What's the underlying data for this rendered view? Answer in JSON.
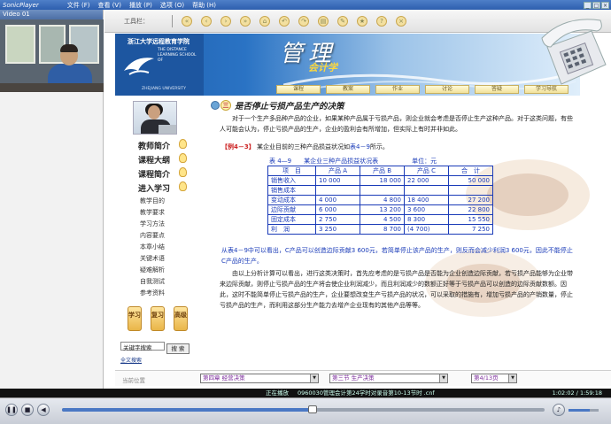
{
  "titlebar": {
    "app_name": "SonicPlayer",
    "menu": [
      "文件 (F)",
      "查看 (V)",
      "播放 (P)",
      "选项 (O)",
      "帮助 (H)"
    ]
  },
  "video_panel": {
    "title": "Video 01"
  },
  "toolbar": {
    "label": "工具栏："
  },
  "banner": {
    "school_cn": "浙江大学远程教育学院",
    "school_en": "THE DISTANCE LEARNING SCHOOL OF",
    "univ": "ZHEJIANG UNIVERSITY",
    "title_main": "管理",
    "title_sub": "会计学"
  },
  "nav_tabs": [
    "课程",
    "教案",
    "作业",
    "讨论",
    "答疑",
    "学习导航"
  ],
  "sidenav": {
    "main": [
      "教师简介",
      "课程大纲",
      "课程简介",
      "进入学习"
    ],
    "sub": [
      "教学目的",
      "教学要求",
      "学习方法",
      "内容要点",
      "本章小结",
      "关键术语",
      "疑难解析",
      "自我测试",
      "参考资料"
    ],
    "buttons": [
      "学习",
      "复习",
      "高级"
    ],
    "search_value": "关键字搜索",
    "search_button": "搜 索",
    "advanced_search": "全文搜索"
  },
  "content": {
    "section_no": "三",
    "section_title": "是否停止亏损产品生产的决策",
    "para1": "对于一个生产多品种产品的企业，如果某种产品属于亏损产品，则企业就会考虑是否停止生产这种产品。对于这类问题，有些人可能会认为，停止亏损产品的生产，企业的盈利会有所增加，但实际上有时并非如此。",
    "example_tag": "【例4－3】",
    "example_text": "某企业目前的三种产品损益状况如",
    "example_link": "表4－9",
    "example_tail": "所示。",
    "table_caption": "表 4—9　　某企业三种产品损益状况表",
    "table_unit": "单位：元",
    "table_headers": [
      "项　目",
      "产品 A",
      "产品 B",
      "产品 C",
      "合　计"
    ],
    "table_rows": [
      [
        "销售收入",
        "10 000",
        "18 000",
        "22 000",
        "50 000"
      ],
      [
        "销售成本",
        "",
        "",
        "",
        ""
      ],
      [
        "变动成本",
        "4 000",
        "4 800",
        "18 400",
        "27 200"
      ],
      [
        "边际贡献",
        "6 000",
        "13 200",
        "3 600",
        "22 800"
      ],
      [
        "固定成本",
        "2 750",
        "4 500",
        "8 300",
        "15 550"
      ],
      [
        "利　润",
        "3 250",
        "8 700",
        "(4 700)",
        "7 250"
      ]
    ],
    "blue_note": "从表4－9中可以看出，C产品可以创造边际贡献3 600元，若简单停止该产品的生产，则反而会减少利润3 600元，因此不能停止C产品的生产。",
    "para2": "由以上分析计算可以看出，进行这类决策时，首先应考虑的是亏损产品是否能为企业创造边际贡献，若亏损产品能够为企业带来边际贡献，则停止亏损产品的生产将会使企业利润减少，而且利润减少的数额正好等于亏损产品可以创造的边际贡献数额。因此，这时不能简单停止亏损产品的生产，企业要想改变生产亏损产品的状况，可以采取的措施有，增加亏损产品的产销数量，停止亏损产品的生产，而利用这部分生产能力去增产企业现有的其他产品等等。"
  },
  "crumbs": {
    "label": "当前位置",
    "chapter": "第四章  经营决策",
    "section": "第三节  生产决策",
    "page": "第4/13页"
  },
  "status": {
    "state": "正在播放",
    "file": "0960030管理会计第24学时对录音第10-13节时 .cnf",
    "time": "1:02:02 / 1:59:18"
  },
  "player": {
    "progress": 0.52,
    "volume": 0.7
  }
}
